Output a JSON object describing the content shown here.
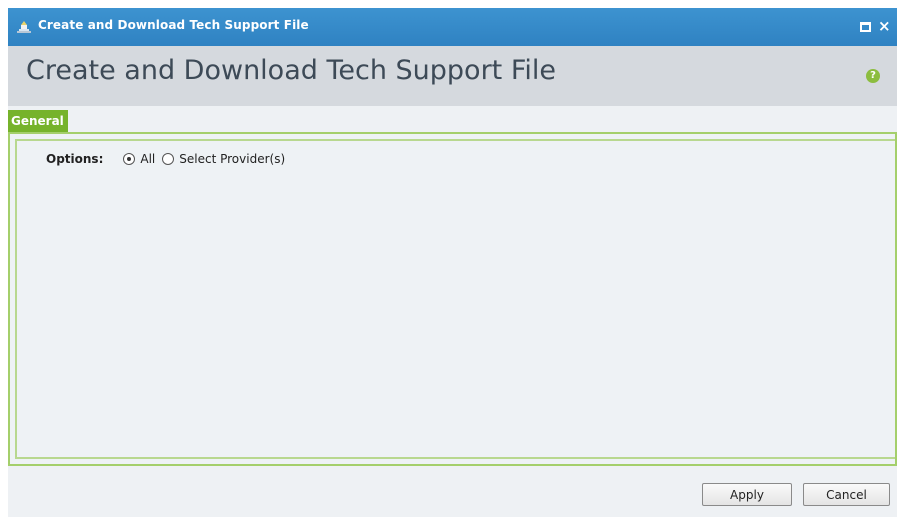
{
  "window": {
    "title": "Create and Download Tech Support File",
    "icons": {
      "app": "app-icon",
      "maximize": "maximize-icon",
      "close": "close-icon",
      "close_glyph": "×"
    }
  },
  "header": {
    "title": "Create and Download Tech Support File",
    "help_icon": "help-icon",
    "help_glyph": "?"
  },
  "tabs": [
    {
      "label": "General",
      "active": true
    }
  ],
  "form": {
    "options_label": "Options:",
    "radio_options": [
      {
        "label": "All",
        "selected": true
      },
      {
        "label": "Select Provider(s)",
        "selected": false
      }
    ]
  },
  "buttons": {
    "apply": "Apply",
    "cancel": "Cancel"
  },
  "colors": {
    "titlebar": "#3d93d0",
    "tab_accent": "#76b32b",
    "help_icon": "#8cbd3f",
    "panel_border": "#a4cf6b"
  }
}
